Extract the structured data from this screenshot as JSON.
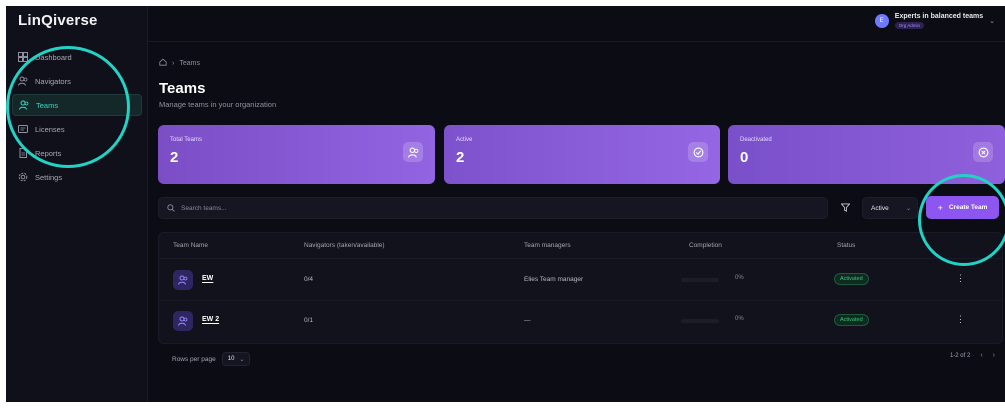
{
  "app": {
    "logo": "LinQiverse"
  },
  "sidebar": {
    "items": [
      {
        "label": "Dashboard",
        "icon": "dashboard-icon",
        "active": false
      },
      {
        "label": "Navigators",
        "icon": "navigators-icon",
        "active": false
      },
      {
        "label": "Teams",
        "icon": "teams-icon",
        "active": true
      },
      {
        "label": "Licenses",
        "icon": "license-icon",
        "active": false
      },
      {
        "label": "Reports",
        "icon": "reports-icon",
        "active": false
      },
      {
        "label": "Settings",
        "icon": "gear-icon",
        "active": false
      }
    ]
  },
  "header": {
    "org_initial": "E",
    "org_name": "Experts in balanced teams",
    "org_role": "Org Admin"
  },
  "breadcrumb": {
    "current": "Teams"
  },
  "page": {
    "title": "Teams",
    "subtitle": "Manage teams in your organization"
  },
  "stats": [
    {
      "label": "Total Teams",
      "value": "2",
      "icon": "users-icon"
    },
    {
      "label": "Active",
      "value": "2",
      "icon": "check-circle-icon"
    },
    {
      "label": "Deactivated",
      "value": "0",
      "icon": "x-circle-icon"
    }
  ],
  "toolbar": {
    "search_placeholder": "Search teams...",
    "status_filter": "Active",
    "create_label": "Create Team"
  },
  "table": {
    "columns": [
      "Team Name",
      "Navigators (taken/available)",
      "Team managers",
      "Completion",
      "Status"
    ],
    "rows": [
      {
        "name": "EW",
        "navigators": "0/4",
        "managers": "Elies Team manager",
        "completion_pct": "0%",
        "completion": 0,
        "status": "Activated"
      },
      {
        "name": "EW 2",
        "navigators": "0/1",
        "managers": "—",
        "completion_pct": "0%",
        "completion": 0,
        "status": "Activated"
      }
    ]
  },
  "pagination": {
    "rows_per_page_label": "Rows per page",
    "rows_per_page": "10",
    "range": "1-2 of 2"
  },
  "colors": {
    "accent": "#8d56f0",
    "active_nav": "#36d6c5",
    "annotation": "#22d3c5",
    "status_active": "#37c77b"
  }
}
